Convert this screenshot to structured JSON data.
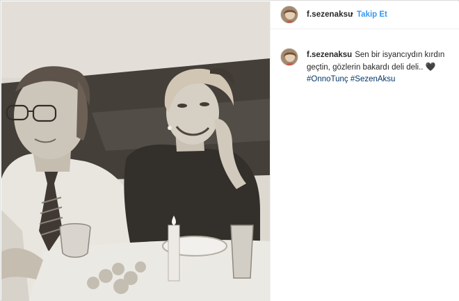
{
  "post": {
    "username": "f.sezenaksu",
    "separator": "•",
    "follow_label": "Takip Et",
    "caption_username": "f.sezenaksu",
    "caption_text": "Sen bir isyancıydın kırdın geçtin, gözlerin bakardı deli deli..",
    "caption_heart": "🖤",
    "hashtags": [
      "#OnnoTunç",
      "#SezenAksu"
    ]
  },
  "icons": {
    "heart": "black-heart-icon",
    "avatar": "profile-avatar"
  }
}
